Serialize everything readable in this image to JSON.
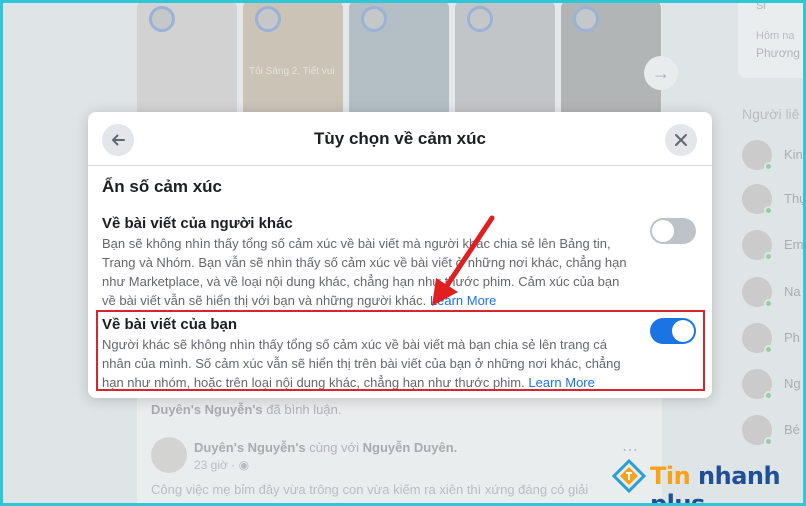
{
  "background": {
    "story_captions": [
      "Tôi Sáng 2, Tiết vui"
    ],
    "comment_line": {
      "name": "Duyên's Nguyễn's",
      "suffix": "đã bình luận."
    },
    "post": {
      "author": "Duyên's Nguyễn's",
      "with_text": "cùng với",
      "tagged": "Nguyễn Duyên.",
      "time": "23 giờ ·",
      "text": "Công việc mẹ bỉm đây vừa trông con vừa kiếm ra xiên thì xứng đáng có giải"
    },
    "right_card": {
      "line1": "Si",
      "line2": "Hôm na",
      "line3": "Phương"
    },
    "contacts_title": "Người liê",
    "contacts": [
      "Kin",
      "Thụ",
      "Em",
      "Na",
      "Ph",
      "Ng",
      "Bé"
    ]
  },
  "modal": {
    "title": "Tùy chọn về cảm xúc",
    "section_title": "Ẩn số cảm xúc",
    "options": [
      {
        "title": "Về bài viết của người khác",
        "desc_lines": [
          "Bạn sẽ không nhìn thấy tổng số cảm xúc về bài viết mà người khác chia sẻ lên Bảng tin,",
          "Trang và Nhóm. Bạn vẫn sẽ nhìn thấy số cảm xúc về bài viết ở những nơi khác, chẳng hạn",
          "như Marketplace, và về loại nội dung khác, chẳng hạn như thước phim. Cảm xúc của bạn",
          "về bài viết vẫn sẽ hiển thị với bạn và những người khác."
        ],
        "learn_more": "Learn More",
        "enabled": false
      },
      {
        "title": "Về bài viết của bạn",
        "desc_lines": [
          "Người khác sẽ không nhìn thấy tổng số cảm xúc về bài viết mà bạn chia sẻ lên trang cá",
          "nhân của mình. Số cảm xúc vẫn sẽ hiển thị trên bài viết của bạn ở những nơi khác, chẳng",
          "hạn như nhóm, hoặc trên loại nội dung khác, chẳng hạn như thước phim."
        ],
        "learn_more": "Learn More",
        "enabled": true
      }
    ]
  },
  "watermark": {
    "brand_part1": "Tin",
    "brand_part2": "nhanh plus"
  },
  "colors": {
    "accent": "#1b74e4",
    "highlight": "#d9232e",
    "frame": "#2fc6d8"
  }
}
